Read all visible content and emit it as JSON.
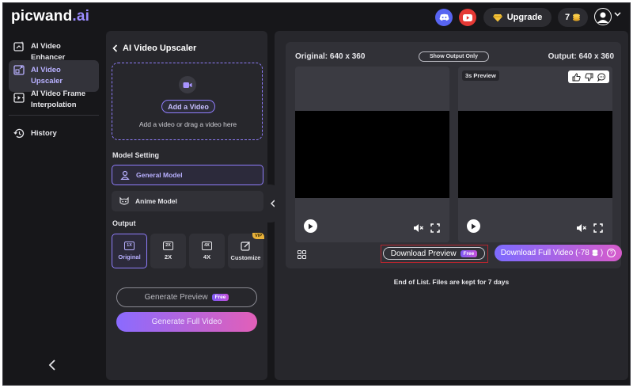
{
  "brand": {
    "name": "picwand",
    "suffix": ".ai"
  },
  "header": {
    "upgrade_label": "Upgrade",
    "credits": "7"
  },
  "sidebar": {
    "items": [
      {
        "label": "AI Video Enhancer",
        "icon": "enhance-icon"
      },
      {
        "label": "AI Video Upscaler",
        "icon": "upscale-icon",
        "active": true
      },
      {
        "label": "AI Video Frame Interpolation",
        "icon": "interpolation-icon"
      },
      {
        "label": "History",
        "icon": "history-icon"
      }
    ]
  },
  "panel": {
    "title": "AI Video Upscaler",
    "add_video_label": "Add a Video",
    "drop_hint": "Add a video or drag a video here",
    "model_setting_label": "Model Setting",
    "models": [
      {
        "label": "General Model",
        "selected": true
      },
      {
        "label": "Anime Model",
        "selected": false
      }
    ],
    "output_label": "Output",
    "outputs": [
      {
        "badge": "1X",
        "label": "Original",
        "selected": true
      },
      {
        "badge": "2X",
        "label": "2X",
        "selected": false
      },
      {
        "badge": "4X",
        "label": "4X",
        "selected": false
      },
      {
        "badge": "",
        "label": "Customize",
        "selected": false,
        "tag": "VIP"
      }
    ],
    "generate_preview_label": "Generate Preview",
    "free_tag": "Free",
    "generate_full_label": "Generate Full Video"
  },
  "result": {
    "original_label": "Original: 640 x 360",
    "output_label": "Output: 640 x 360",
    "show_output_only_label": "Show Output Only",
    "preview_badge": "3s Preview",
    "download_preview_label": "Download Preview",
    "download_free_tag": "Free",
    "download_full_label": "Download Full Video (-78",
    "download_full_suffix": ")",
    "help_label": "?",
    "end_text": "End of List. Files are kept for 7 days"
  },
  "colors": {
    "accent": "#8f7dfb",
    "background": "#17171a",
    "panel": "#27272c",
    "gradient_start": "#8a6bff",
    "gradient_end": "#e25fb8"
  }
}
